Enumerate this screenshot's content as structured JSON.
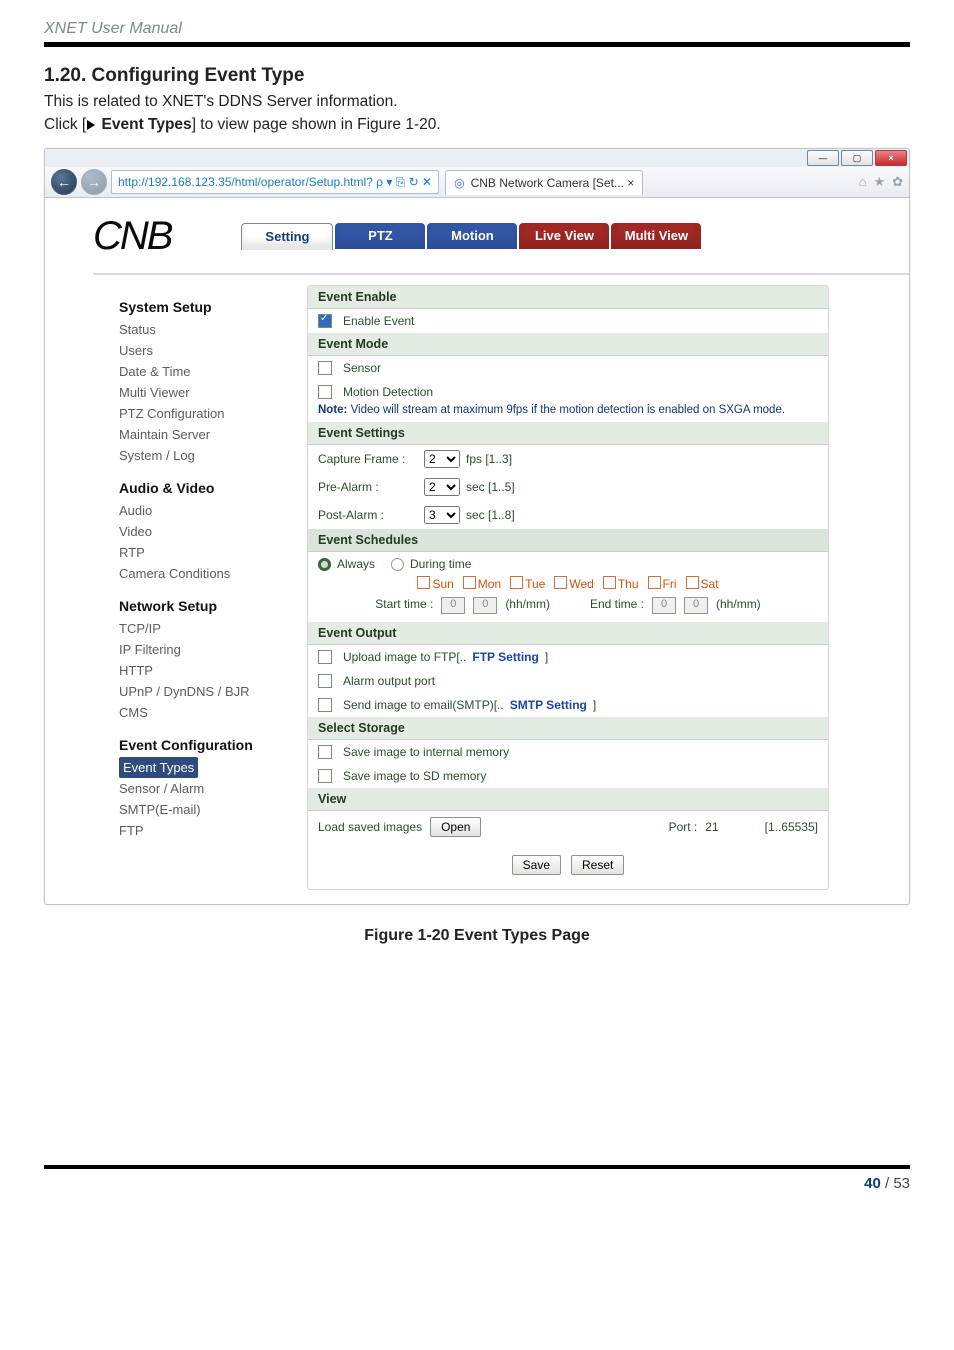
{
  "doc_header": "XNET User Manual",
  "section": {
    "number_title": "1.20. Configuring Event Type",
    "line1": "This is related to XNET's DDNS Server information.",
    "line2_prefix": "Click [",
    "line2_bold": "Event Types",
    "line2_suffix": "] to view page shown in Figure 1-20."
  },
  "window": {
    "min": "—",
    "max": "▢",
    "close": "×",
    "url_text": "http://192.168.123.35/html/operator/Setup.html?  ρ ▾  ⎘ ↻ ✕",
    "tab_title": "CNB Network Camera [Set...  ×",
    "right_icons": [
      "⌂",
      "★",
      "✿"
    ]
  },
  "brand": "CNB",
  "tabs": {
    "setting": "Setting",
    "ptz": "PTZ",
    "motion": "Motion",
    "live": "Live View",
    "multi": "Multi View"
  },
  "sidebar": {
    "g1": "System Setup",
    "g1_items": [
      "Status",
      "Users",
      "Date & Time",
      "Multi Viewer",
      "PTZ Configuration",
      "Maintain Server",
      "System / Log"
    ],
    "g2": "Audio & Video",
    "g2_items": [
      "Audio",
      "Video",
      "RTP",
      "Camera Conditions"
    ],
    "g3": "Network Setup",
    "g3_items": [
      "TCP/IP",
      "IP Filtering",
      "HTTP",
      "UPnP / DynDNS / BJR",
      "CMS"
    ],
    "g4": "Event Configuration",
    "g4_items": [
      "Event Types",
      "Sensor / Alarm",
      "SMTP(E-mail)",
      "FTP"
    ]
  },
  "panel": {
    "event_enable": "Event Enable",
    "enable_event": "Enable Event",
    "event_mode": "Event Mode",
    "sensor": "Sensor",
    "motion_detection": "Motion Detection",
    "note_label": "Note:",
    "note_text": "Video will stream at maximum 9fps if the motion detection is enabled on SXGA mode.",
    "event_settings": "Event Settings",
    "capture_frame": "Capture Frame :",
    "capture_val": "2",
    "capture_hint": "fps [1..3]",
    "pre_alarm": "Pre-Alarm :",
    "pre_val": "2",
    "pre_hint": "sec [1..5]",
    "post_alarm": "Post-Alarm :",
    "post_val": "3",
    "post_hint": "sec [1..8]",
    "event_schedules": "Event Schedules",
    "always": "Always",
    "during": "During time",
    "days": [
      "Sun",
      "Mon",
      "Tue",
      "Wed",
      "Thu",
      "Fri",
      "Sat"
    ],
    "start_time": "Start time :",
    "end_time": "End time :",
    "hhmm": "(hh/mm)",
    "zero": "0",
    "event_output": "Event Output",
    "upload_ftp_a": "Upload image to FTP[..",
    "upload_ftp_b": "FTP Setting",
    "upload_ftp_c": "]",
    "alarm_output": "Alarm output port",
    "send_smtp_a": "Send image to email(SMTP)[..",
    "send_smtp_b": "SMTP Setting",
    "send_smtp_c": "]",
    "select_storage": "Select Storage",
    "save_internal": "Save image to internal memory",
    "save_sd": "Save image to SD memory",
    "view": "View",
    "load_saved": "Load saved images",
    "open": "Open",
    "port_label": "Port :",
    "port_val": "21",
    "port_hint": "[1..65535]",
    "save_btn": "Save",
    "reset_btn": "Reset"
  },
  "figure_caption": "Figure 1-20 Event Types Page",
  "footer": {
    "cur": "40",
    "sep": " / ",
    "total": "53"
  }
}
